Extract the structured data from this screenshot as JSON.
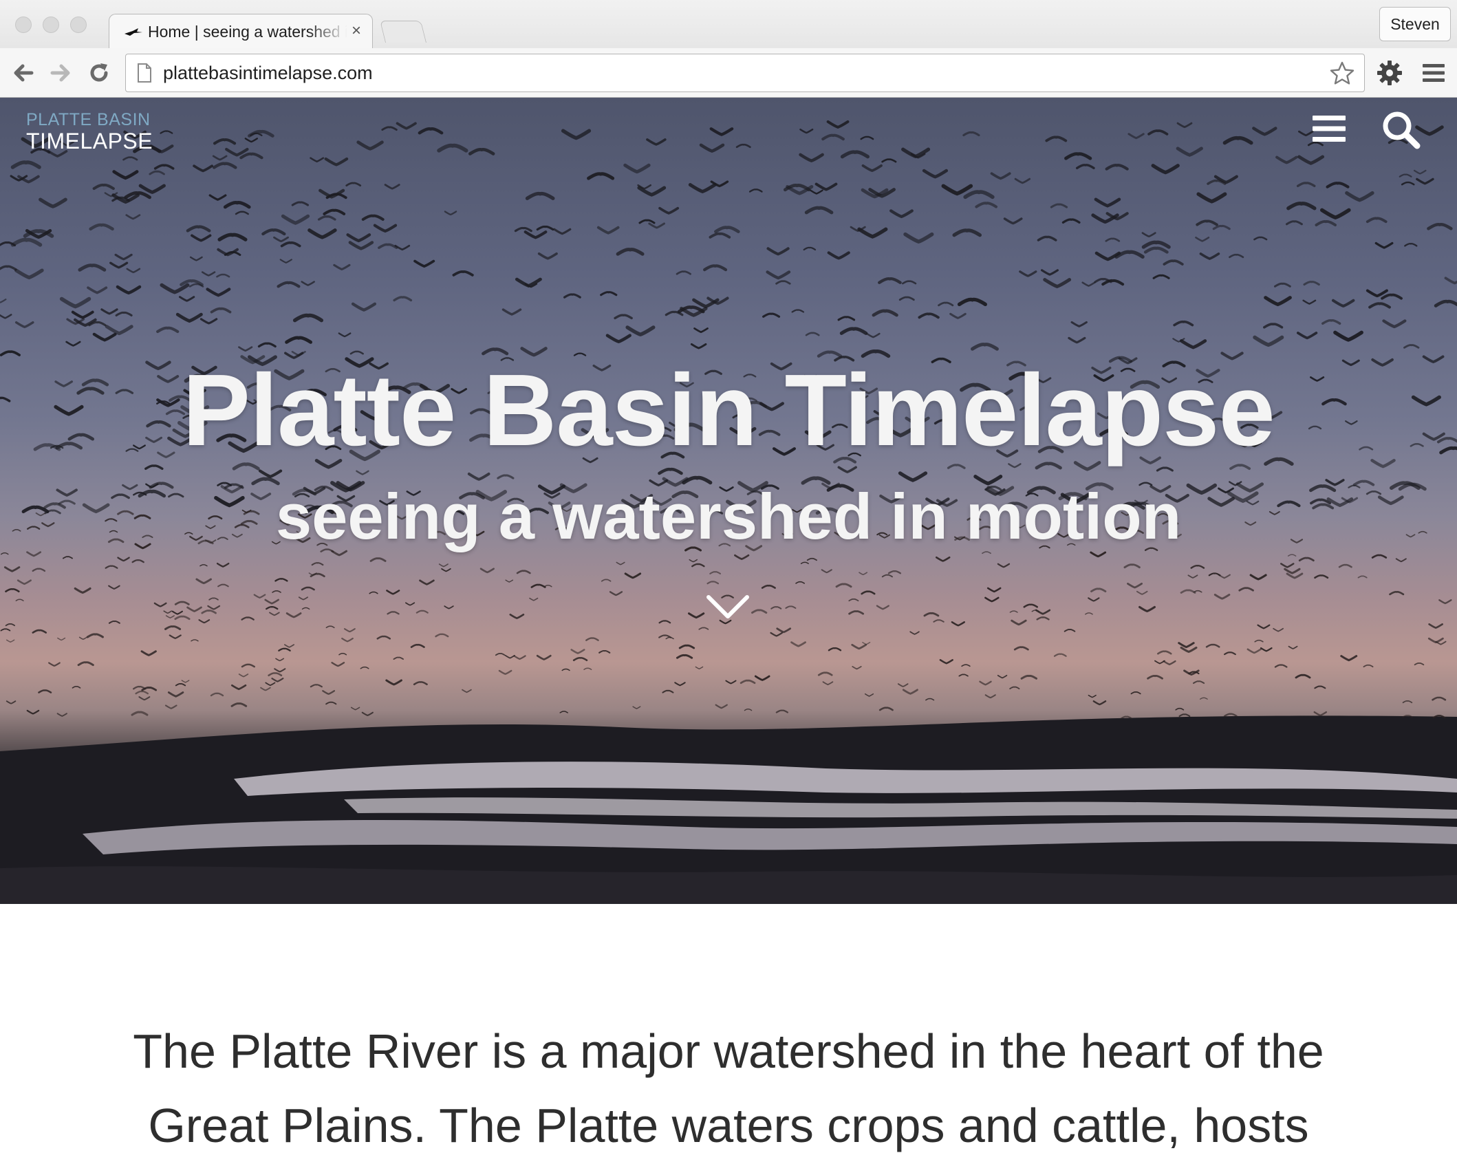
{
  "browser": {
    "tab_title": "Home | seeing a watershed in motion",
    "tab_close": "×",
    "profile_name": "Steven",
    "url": "plattebasintimelapse.com"
  },
  "site": {
    "logo_line1": "PLATTE BASIN",
    "logo_line2": "TIMELAPSE",
    "hero_title": "Platte Basin Timelapse",
    "hero_subtitle": "seeing a watershed in motion",
    "intro": "The Platte River is a major watershed in the heart of the Great Plains. The Platte waters crops and cattle, hosts"
  },
  "icons": {
    "back": "arrow-left-icon",
    "forward": "arrow-right-icon",
    "reload": "reload-icon",
    "page": "page-icon",
    "bookmark": "star-icon",
    "extensions": "gear-icon",
    "browser_menu": "hamburger-icon",
    "site_menu": "hamburger-icon",
    "site_search": "search-icon",
    "scroll": "chevron-down-icon"
  },
  "colors": {
    "logo_accent": "#7fa9c4",
    "hero_text": "#f4f4f4",
    "body_text": "#2e2e2e"
  }
}
